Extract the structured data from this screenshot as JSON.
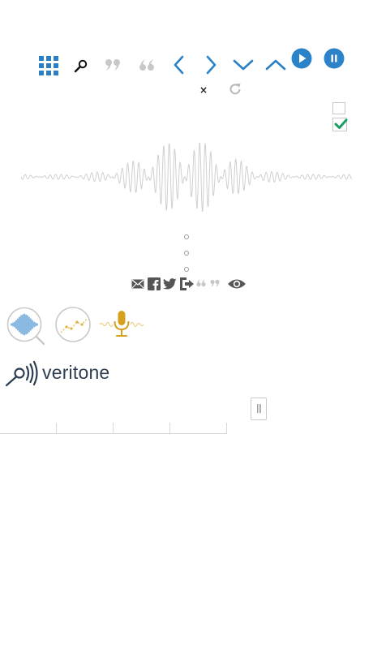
{
  "brand": {
    "name": "veritone"
  },
  "toolbar": {
    "buttons": [
      {
        "name": "grid-apps",
        "icon": "grid-icon"
      },
      {
        "name": "search",
        "icon": "search-icon"
      },
      {
        "name": "quote-close",
        "icon": "quote-close-icon"
      },
      {
        "name": "quote-open",
        "icon": "quote-open-icon"
      },
      {
        "name": "previous",
        "icon": "chevron-left-icon"
      },
      {
        "name": "next",
        "icon": "chevron-right-icon"
      },
      {
        "name": "expand",
        "icon": "chevron-down-icon"
      },
      {
        "name": "collapse",
        "icon": "chevron-up-icon"
      },
      {
        "name": "play",
        "icon": "play-icon"
      },
      {
        "name": "pause",
        "icon": "pause-icon"
      }
    ],
    "close_label": "×"
  },
  "share": {
    "icons": [
      "email-icon",
      "facebook-icon",
      "twitter-icon",
      "export-icon",
      "quotes-icon",
      "eye-icon"
    ]
  },
  "engines": {
    "icons": [
      "audio-search-icon",
      "analytics-icon",
      "microphone-icon"
    ]
  },
  "colors": {
    "accent_blue": "#2b82c9",
    "grid_blue": "#2b7ec1",
    "muted_gray": "#c8c8c8",
    "waveform_gray": "#cfcfcf",
    "check_green": "#1a9e62",
    "mic_gold": "#d4a01e",
    "brand_dark": "#2d3e50"
  },
  "checkboxes": [
    {
      "checked": false
    },
    {
      "checked": true
    }
  ],
  "tabs": {
    "count": 4
  }
}
